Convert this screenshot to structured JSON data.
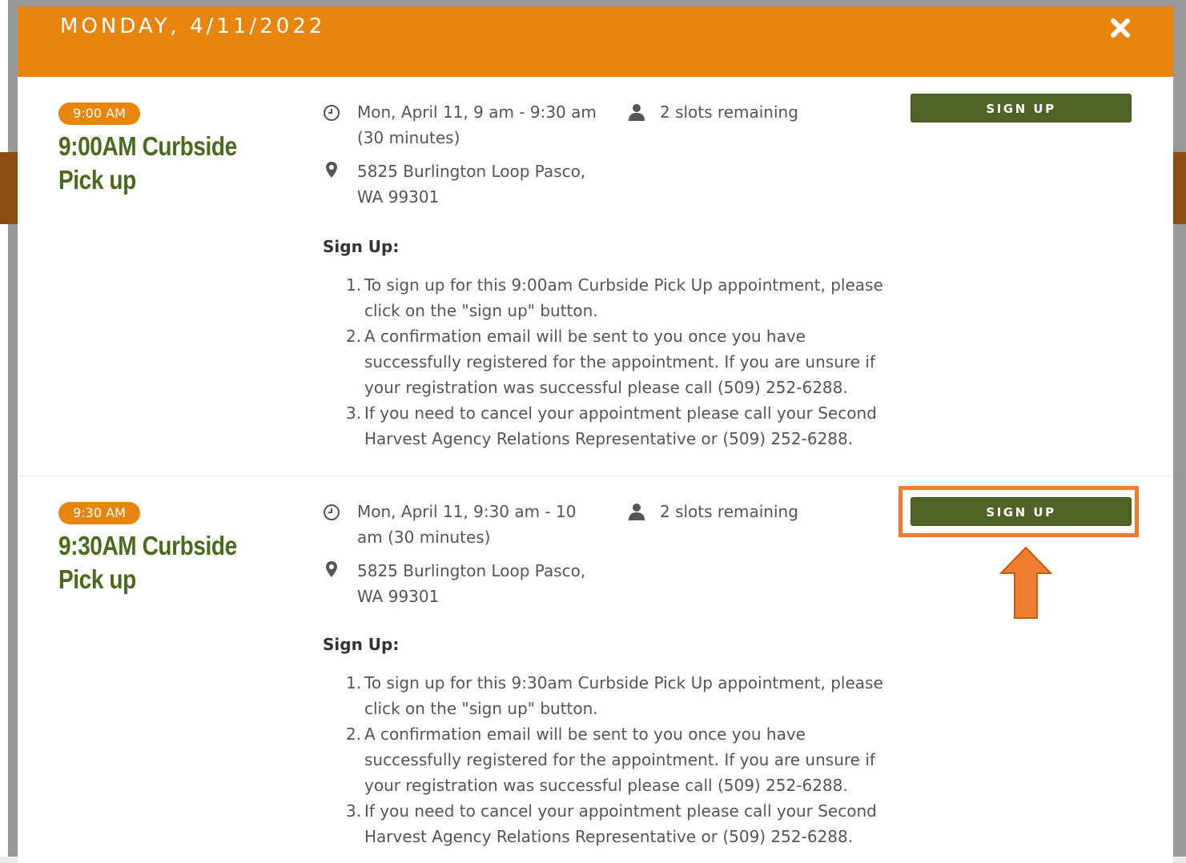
{
  "modal": {
    "title": "MONDAY, 4/11/2022",
    "close_icon": "close-icon"
  },
  "colors": {
    "header_bg": "#e8850d",
    "title_green": "#4a6b1d",
    "button_green": "#4f6324",
    "highlight": "#ee7d31"
  },
  "slots": [
    {
      "badge": "9:00 AM",
      "title": "9:00AM Curbside Pick up",
      "date_time": "Mon, April 11, 9 am - 9:30 am (30 minutes)",
      "location": "5825 Burlington Loop Pasco, WA 99301",
      "remaining": "2 slots remaining",
      "button_label": "SIGN UP",
      "signup_heading": "Sign Up:",
      "steps": [
        {
          "num": "1.",
          "text": "To sign up for this 9:00am Curbside Pick Up appointment, please click on the \"sign up\" button."
        },
        {
          "num": "2.",
          "text": "A confirmation email will be sent to you once you have successfully registered for the appointment. If you are unsure if your registration was successful please call (509) 252-6288."
        },
        {
          "num": "3.",
          "text": "If you need to cancel your appointment please call your Second Harvest Agency Relations Representative or (509) 252-6288."
        }
      ]
    },
    {
      "badge": "9:30 AM",
      "title": "9:30AM Curbside Pick up",
      "date_time": "Mon, April 11, 9:30 am - 10 am (30 minutes)",
      "location": "5825 Burlington Loop Pasco, WA 99301",
      "remaining": "2 slots remaining",
      "button_label": "SIGN UP",
      "signup_heading": "Sign Up:",
      "steps": [
        {
          "num": "1.",
          "text": "To sign up for this 9:30am Curbside Pick Up appointment, please click on the \"sign up\" button."
        },
        {
          "num": "2.",
          "text": "A confirmation email will be sent to you once you have successfully registered for the appointment. If you are unsure if your registration was successful please call (509) 252-6288."
        },
        {
          "num": "3.",
          "text": "If you need to cancel your appointment please call your Second Harvest Agency Relations Representative or (509) 252-6288."
        }
      ]
    }
  ],
  "icons": {
    "clock": "clock-icon",
    "person": "person-icon",
    "location": "map-pin-icon",
    "arrow": "arrow-up-icon"
  }
}
